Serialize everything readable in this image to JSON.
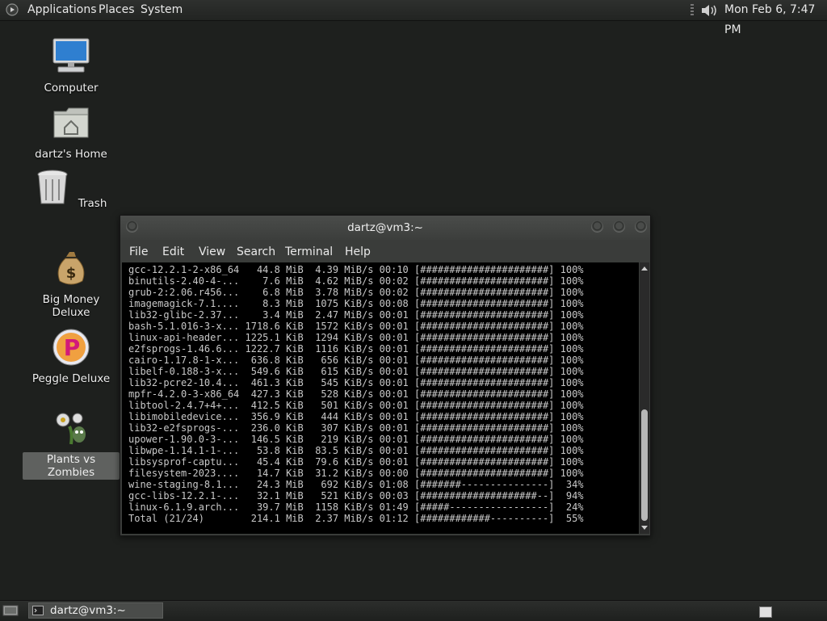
{
  "top_panel": {
    "menus": [
      "Applications",
      "Places",
      "System"
    ],
    "clock": "Mon Feb  6,  7:47 PM"
  },
  "desktop_icons": [
    {
      "label": "Computer",
      "icon": "computer-icon"
    },
    {
      "label": "dartz's Home",
      "icon": "home-folder-icon"
    },
    {
      "label": "Trash",
      "icon": "trash-icon"
    },
    {
      "label": "Big Money Deluxe",
      "icon": "money-bag-icon"
    },
    {
      "label": "Peggle Deluxe",
      "icon": "peggle-icon"
    },
    {
      "label": "Plants vs Zombies",
      "icon": "plants-vs-zombies-icon",
      "selected": true
    }
  ],
  "terminal": {
    "title": "dartz@vm3:~",
    "menu": [
      "File",
      "Edit",
      "View",
      "Search",
      "Terminal",
      "Help"
    ],
    "lines": [
      "gcc-12.2.1-2-x86_64   44.8 MiB  4.39 MiB/s 00:10 [######################] 100%",
      "binutils-2.40-4-...    7.6 MiB  4.62 MiB/s 00:02 [######################] 100%",
      "grub-2:2.06.r456...    6.8 MiB  3.78 MiB/s 00:02 [######################] 100%",
      "imagemagick-7.1....    8.3 MiB  1075 KiB/s 00:08 [######################] 100%",
      "lib32-glibc-2.37...    3.4 MiB  2.47 MiB/s 00:01 [######################] 100%",
      "bash-5.1.016-3-x... 1718.6 KiB  1572 KiB/s 00:01 [######################] 100%",
      "linux-api-header... 1225.1 KiB  1294 KiB/s 00:01 [######################] 100%",
      "e2fsprogs-1.46.6... 1222.7 KiB  1116 KiB/s 00:01 [######################] 100%",
      "cairo-1.17.8-1-x...  636.8 KiB   656 KiB/s 00:01 [######################] 100%",
      "libelf-0.188-3-x...  549.6 KiB   615 KiB/s 00:01 [######################] 100%",
      "lib32-pcre2-10.4...  461.3 KiB   545 KiB/s 00:01 [######################] 100%",
      "mpfr-4.2.0-3-x86_64  427.3 KiB   528 KiB/s 00:01 [######################] 100%",
      "libtool-2.4.7+4+...  412.5 KiB   501 KiB/s 00:01 [######################] 100%",
      "libimobiledevice...  356.9 KiB   444 KiB/s 00:01 [######################] 100%",
      "lib32-e2fsprogs-...  236.0 KiB   307 KiB/s 00:01 [######################] 100%",
      "upower-1.90.0-3-...  146.5 KiB   219 KiB/s 00:01 [######################] 100%",
      "libwpe-1.14.1-1-...   53.8 KiB  83.5 KiB/s 00:01 [######################] 100%",
      "libsysprof-captu...   45.4 KiB  79.6 KiB/s 00:01 [######################] 100%",
      "filesystem-2023....   14.7 KiB  31.2 KiB/s 00:00 [######################] 100%",
      "wine-staging-8.1...   24.3 MiB   692 KiB/s 01:08 [#######---------------]  34%",
      "gcc-libs-12.2.1-...   32.1 MiB   521 KiB/s 00:03 [####################--]  94%",
      "linux-6.1.9.arch...   39.7 MiB  1158 KiB/s 01:49 [#####-----------------]  24%",
      "Total (21/24)        214.1 MiB  2.37 MiB/s 01:12 [############----------]  55%"
    ]
  },
  "bottom_panel": {
    "task_label": "dartz@vm3:~"
  }
}
